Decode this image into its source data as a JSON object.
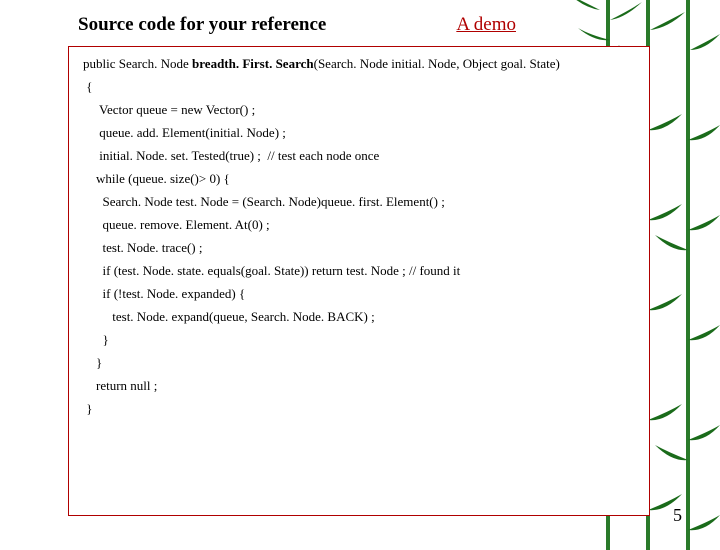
{
  "header": {
    "title": "Source code for your reference",
    "link": "A demo"
  },
  "code": {
    "sig_pre": "public Search. Node ",
    "sig_bold": "breadth. First. Search",
    "sig_post": "(Search. Node initial. Node, Object goal. State)",
    "l1": " {",
    "l2": "     Vector queue = new Vector() ;",
    "l3": "     queue. add. Element(initial. Node) ;",
    "l4": "     initial. Node. set. Tested(true) ;  // test each node once",
    "l5": "",
    "l6": "    while (queue. size()> 0) {",
    "l7": "      Search. Node test. Node = (Search. Node)queue. first. Element() ;",
    "l8": "      queue. remove. Element. At(0) ;",
    "l9": "      test. Node. trace() ;",
    "l10": "      if (test. Node. state. equals(goal. State)) return test. Node ; // found it",
    "l11": "",
    "l12": "      if (!test. Node. expanded) {",
    "l13": "         test. Node. expand(queue, Search. Node. BACK) ;",
    "l14": "      }",
    "l15": "    }",
    "l16": "    return null ;",
    "l17": "",
    "l18": " }"
  },
  "page_number": "5"
}
